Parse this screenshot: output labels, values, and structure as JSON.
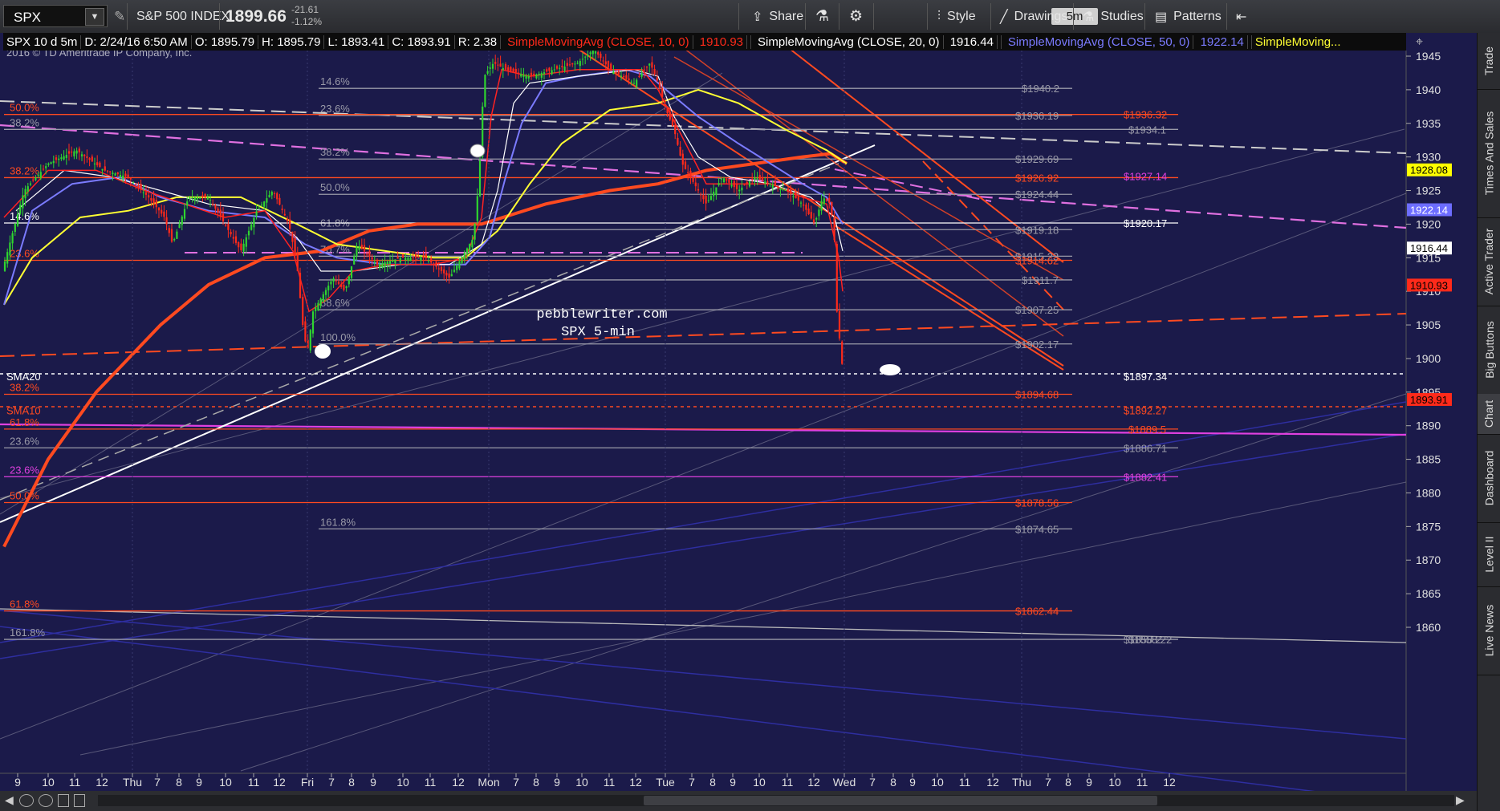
{
  "toolbar": {
    "symbol": "SPX",
    "name": "S&P 500 INDEX",
    "price": "1899.66",
    "change": "-21.61",
    "change_pct": "-1.12%",
    "share": "Share",
    "timeframe": "5m",
    "style": "Style",
    "drawings": "Drawings",
    "studies": "Studies",
    "patterns": "Patterns"
  },
  "infobar": {
    "desc": "SPX 10 d 5m",
    "date": "D: 2/24/16 6:50 AM",
    "open": "O: 1895.79",
    "high": "H: 1895.79",
    "low": "L: 1893.41",
    "close": "C: 1893.91",
    "range": "R: 2.38",
    "sma10": "SimpleMovingAvg (CLOSE, 10, 0)",
    "sma10_val": "1910.93",
    "sma20": "SimpleMovingAvg (CLOSE, 20, 0)",
    "sma20_val": "1916.44",
    "sma50": "SimpleMovingAvg (CLOSE, 50, 0)",
    "sma50_val": "1922.14",
    "sma_more": "SimpleMoving..."
  },
  "copyright": "2016 © TD Ameritrade IP Company, Inc.",
  "watermark": [
    "pebblewriter.com",
    "SPX 5-min"
  ],
  "right_nav": [
    "Trade",
    "Times And Sales",
    "Active Trader",
    "Big Buttons",
    "Chart",
    "Dashboard",
    "Level II",
    "Live News"
  ],
  "chart_data": {
    "type": "candlestick",
    "interval": "5m",
    "ylim": [
      1857,
      1948
    ],
    "yticks": [
      1860,
      1865,
      1870,
      1875,
      1880,
      1885,
      1890,
      1895,
      1900,
      1905,
      1910,
      1915,
      1920,
      1925,
      1930,
      1935,
      1940,
      1945
    ],
    "xticks": [
      {
        "label": "9",
        "x": 22
      },
      {
        "label": "10",
        "x": 60
      },
      {
        "label": "11",
        "x": 93
      },
      {
        "label": "12",
        "x": 127
      },
      {
        "label": "Thu",
        "x": 165
      },
      {
        "label": "7",
        "x": 196
      },
      {
        "label": "8",
        "x": 223
      },
      {
        "label": "9",
        "x": 248
      },
      {
        "label": "10",
        "x": 281
      },
      {
        "label": "11",
        "x": 316
      },
      {
        "label": "12",
        "x": 348
      },
      {
        "label": "Fri",
        "x": 383
      },
      {
        "label": "7",
        "x": 413
      },
      {
        "label": "8",
        "x": 438
      },
      {
        "label": "9",
        "x": 465
      },
      {
        "label": "10",
        "x": 502
      },
      {
        "label": "11",
        "x": 536
      },
      {
        "label": "12",
        "x": 571
      },
      {
        "label": "Mon",
        "x": 609
      },
      {
        "label": "7",
        "x": 643
      },
      {
        "label": "8",
        "x": 668
      },
      {
        "label": "9",
        "x": 694
      },
      {
        "label": "10",
        "x": 725
      },
      {
        "label": "11",
        "x": 759
      },
      {
        "label": "12",
        "x": 792
      },
      {
        "label": "Tue",
        "x": 829
      },
      {
        "label": "7",
        "x": 862
      },
      {
        "label": "8",
        "x": 888
      },
      {
        "label": "9",
        "x": 913
      },
      {
        "label": "10",
        "x": 946
      },
      {
        "label": "11",
        "x": 981
      },
      {
        "label": "12",
        "x": 1014
      },
      {
        "label": "Wed",
        "x": 1052
      },
      {
        "label": "7",
        "x": 1087
      },
      {
        "label": "8",
        "x": 1113
      },
      {
        "label": "9",
        "x": 1137
      },
      {
        "label": "10",
        "x": 1168
      },
      {
        "label": "11",
        "x": 1202
      },
      {
        "label": "12",
        "x": 1237
      },
      {
        "label": "Thu",
        "x": 1273
      },
      {
        "label": "7",
        "x": 1306
      },
      {
        "label": "8",
        "x": 1331
      },
      {
        "label": "9",
        "x": 1357
      },
      {
        "label": "10",
        "x": 1389
      },
      {
        "label": "11",
        "x": 1423
      },
      {
        "label": "12",
        "x": 1457
      }
    ],
    "price_path": [
      [
        5,
        1914
      ],
      [
        30,
        1925
      ],
      [
        60,
        1929
      ],
      [
        95,
        1931
      ],
      [
        130,
        1928
      ],
      [
        160,
        1927
      ],
      [
        185,
        1924
      ],
      [
        205,
        1921
      ],
      [
        215,
        1917
      ],
      [
        235,
        1924
      ],
      [
        260,
        1924
      ],
      [
        285,
        1919
      ],
      [
        300,
        1916
      ],
      [
        320,
        1922
      ],
      [
        340,
        1925
      ],
      [
        360,
        1920
      ],
      [
        370,
        1914
      ],
      [
        378,
        1904
      ],
      [
        383,
        1901
      ],
      [
        390,
        1907
      ],
      [
        400,
        1909
      ],
      [
        415,
        1912
      ],
      [
        430,
        1910
      ],
      [
        445,
        1917
      ],
      [
        470,
        1914
      ],
      [
        500,
        1915
      ],
      [
        530,
        1915
      ],
      [
        560,
        1912
      ],
      [
        575,
        1915
      ],
      [
        590,
        1918
      ],
      [
        597,
        1927
      ],
      [
        603,
        1942
      ],
      [
        615,
        1944
      ],
      [
        630,
        1943
      ],
      [
        660,
        1942
      ],
      [
        690,
        1943
      ],
      [
        720,
        1944
      ],
      [
        740,
        1946
      ],
      [
        760,
        1943
      ],
      [
        790,
        1941
      ],
      [
        810,
        1944
      ],
      [
        820,
        1941
      ],
      [
        830,
        1937
      ],
      [
        840,
        1934
      ],
      [
        850,
        1929
      ],
      [
        865,
        1926
      ],
      [
        880,
        1923
      ],
      [
        900,
        1927
      ],
      [
        920,
        1925
      ],
      [
        940,
        1927
      ],
      [
        960,
        1926
      ],
      [
        980,
        1925
      ],
      [
        1000,
        1923
      ],
      [
        1015,
        1920
      ],
      [
        1025,
        1924
      ],
      [
        1035,
        1923
      ],
      [
        1041,
        1916
      ],
      [
        1043,
        1906
      ],
      [
        1048,
        1901
      ],
      [
        1052,
        1895
      ],
      [
        1053,
        1894
      ]
    ],
    "sma10_path": [
      [
        5,
        1921
      ],
      [
        60,
        1928
      ],
      [
        120,
        1928
      ],
      [
        180,
        1925
      ],
      [
        230,
        1923
      ],
      [
        280,
        1921
      ],
      [
        330,
        1922
      ],
      [
        365,
        1916
      ],
      [
        385,
        1907
      ],
      [
        410,
        1909
      ],
      [
        440,
        1913
      ],
      [
        480,
        1914
      ],
      [
        540,
        1914
      ],
      [
        580,
        1915
      ],
      [
        600,
        1921
      ],
      [
        612,
        1936
      ],
      [
        625,
        1943
      ],
      [
        660,
        1942
      ],
      [
        720,
        1943
      ],
      [
        760,
        1943
      ],
      [
        800,
        1943
      ],
      [
        820,
        1940
      ],
      [
        850,
        1933
      ],
      [
        880,
        1926
      ],
      [
        920,
        1926
      ],
      [
        960,
        1926
      ],
      [
        1000,
        1924
      ],
      [
        1030,
        1923
      ],
      [
        1045,
        1915
      ],
      [
        1050,
        1910
      ]
    ],
    "sma20_path": [
      [
        20,
        1922
      ],
      [
        80,
        1928
      ],
      [
        140,
        1927
      ],
      [
        200,
        1925
      ],
      [
        260,
        1923
      ],
      [
        330,
        1922
      ],
      [
        370,
        1918
      ],
      [
        400,
        1913
      ],
      [
        440,
        1913
      ],
      [
        500,
        1914
      ],
      [
        560,
        1914
      ],
      [
        600,
        1917
      ],
      [
        620,
        1925
      ],
      [
        640,
        1938
      ],
      [
        660,
        1941
      ],
      [
        720,
        1942
      ],
      [
        790,
        1943
      ],
      [
        820,
        1942
      ],
      [
        840,
        1936
      ],
      [
        870,
        1930
      ],
      [
        910,
        1927
      ],
      [
        960,
        1926
      ],
      [
        1010,
        1924
      ],
      [
        1040,
        1921
      ],
      [
        1050,
        1916
      ]
    ],
    "sma50_path": [
      [
        5,
        1908
      ],
      [
        40,
        1922
      ],
      [
        90,
        1926
      ],
      [
        150,
        1927
      ],
      [
        200,
        1924
      ],
      [
        260,
        1922
      ],
      [
        330,
        1921
      ],
      [
        380,
        1917
      ],
      [
        420,
        1915
      ],
      [
        480,
        1914
      ],
      [
        540,
        1914
      ],
      [
        580,
        1914
      ],
      [
        610,
        1918
      ],
      [
        630,
        1927
      ],
      [
        650,
        1935
      ],
      [
        680,
        1941
      ],
      [
        720,
        1942
      ],
      [
        780,
        1943
      ],
      [
        810,
        1942
      ],
      [
        840,
        1939
      ],
      [
        870,
        1936
      ],
      [
        920,
        1932
      ],
      [
        960,
        1929
      ],
      [
        1000,
        1926
      ],
      [
        1030,
        1924
      ],
      [
        1050,
        1920
      ]
    ],
    "sma100_path": [
      [
        5,
        1908
      ],
      [
        40,
        1915
      ],
      [
        100,
        1921
      ],
      [
        160,
        1922
      ],
      [
        220,
        1924
      ],
      [
        300,
        1924
      ],
      [
        370,
        1920
      ],
      [
        420,
        1917
      ],
      [
        480,
        1916
      ],
      [
        540,
        1915
      ],
      [
        580,
        1915
      ],
      [
        620,
        1919
      ],
      [
        660,
        1926
      ],
      [
        700,
        1932
      ],
      [
        760,
        1937
      ],
      [
        820,
        1938
      ],
      [
        870,
        1940
      ],
      [
        920,
        1938
      ],
      [
        980,
        1934
      ],
      [
        1030,
        1931
      ],
      [
        1055,
        1929
      ]
    ],
    "sma200_path": [
      [
        5,
        1872
      ],
      [
        60,
        1885
      ],
      [
        120,
        1895
      ],
      [
        200,
        1905
      ],
      [
        260,
        1911
      ],
      [
        330,
        1915
      ],
      [
        400,
        1916
      ],
      [
        460,
        1919
      ],
      [
        520,
        1920
      ],
      [
        600,
        1920
      ],
      [
        680,
        1923
      ],
      [
        760,
        1925
      ],
      [
        820,
        1926
      ],
      [
        880,
        1928
      ],
      [
        940,
        1929
      ],
      [
        1000,
        1930
      ],
      [
        1035,
        1930.5
      ],
      [
        1055,
        1929
      ]
    ],
    "fib_lines": [
      {
        "label": "14.6%",
        "label_x": 397,
        "value": 1940.2,
        "x1": 397,
        "x2": 1336,
        "color": "#9a9aa8"
      },
      {
        "label": "23.6%",
        "label_x": 397,
        "value": 1936.19,
        "x1": 397,
        "x2": 1336,
        "color": "#9a9aa8"
      },
      {
        "label": "38.2%",
        "label_x": 397,
        "value": 1929.69,
        "x1": 397,
        "x2": 1336,
        "color": "#9a9aa8"
      },
      {
        "label": "50.0%",
        "label_x": 397,
        "value": 1924.44,
        "x1": 397,
        "x2": 1336,
        "color": "#9a9aa8"
      },
      {
        "label": "61.8%",
        "label_x": 397,
        "value": 1919.18,
        "x1": 397,
        "x2": 1336,
        "color": "#9a9aa8"
      },
      {
        "label": "70.7%",
        "label_x": 397,
        "value": 1915.23,
        "x1": 397,
        "x2": 1336,
        "color": "#9a9aa8"
      },
      {
        "label": "",
        "label_x": 397,
        "value": 1911.7,
        "x1": 397,
        "x2": 1336,
        "color": "#9a9aa8"
      },
      {
        "label": "88.6%",
        "label_x": 397,
        "value": 1907.25,
        "x1": 397,
        "x2": 1336,
        "color": "#9a9aa8"
      },
      {
        "label": "100.0%",
        "label_x": 397,
        "value": 1902.17,
        "x1": 397,
        "x2": 1336,
        "color": "#9a9aa8"
      },
      {
        "label": "161.8%",
        "label_x": 397,
        "value": 1874.65,
        "x1": 397,
        "x2": 1336,
        "color": "#9a9aa8"
      },
      {
        "label": "50.0%",
        "label_x": 10,
        "value": 1936.32,
        "x1": 5,
        "x2": 1468,
        "color": "#ff4a20"
      },
      {
        "label": "38.2%",
        "label_x": 10,
        "value": 1934.1,
        "x1": 5,
        "x2": 1468,
        "color": "#9a9aa8"
      },
      {
        "label": "38.2%",
        "label_x": 10,
        "value": 1926.92,
        "x1": 5,
        "x2": 1468,
        "color": "#ff4a20"
      },
      {
        "label": "14.6%",
        "label_x": 10,
        "value": 1920.17,
        "x1": 5,
        "x2": 1468,
        "color": "#ffffff"
      },
      {
        "label": "23.6%",
        "label_x": 10,
        "value": 1914.62,
        "x1": 5,
        "x2": 1336,
        "color": "#ff4a20"
      },
      {
        "label": "38.2%",
        "label_x": 10,
        "value": 1894.68,
        "x1": 5,
        "x2": 1336,
        "color": "#ff4a20"
      },
      {
        "label": "61.8%",
        "label_x": 10,
        "value": 1889.5,
        "x1": 5,
        "x2": 1468,
        "color": "#ff4a20"
      },
      {
        "label": "23.6%",
        "label_x": 10,
        "value": 1886.71,
        "x1": 5,
        "x2": 1468,
        "color": "#9a9aa8"
      },
      {
        "label": "23.6%",
        "label_x": 10,
        "value": 1882.41,
        "x1": 5,
        "x2": 1468,
        "color": "#e040e0"
      },
      {
        "label": "50.0%",
        "label_x": 10,
        "value": 1878.56,
        "x1": 5,
        "x2": 1336,
        "color": "#ff4a20"
      },
      {
        "label": "61.8%",
        "label_x": 10,
        "value": 1862.44,
        "x1": 5,
        "x2": 1336,
        "color": "#ff4a20"
      },
      {
        "label": "161.8%",
        "label_x": 10,
        "value": 1858.2,
        "x1": 5,
        "x2": 1468,
        "color": "#9a9aa8"
      }
    ],
    "right_labels": [
      {
        "text": "$1940.2",
        "value": 1940.2,
        "x": 1273,
        "color": "#9a9aa8"
      },
      {
        "text": "$1936.19",
        "value": 1936.19,
        "x": 1265,
        "color": "#9a9aa8"
      },
      {
        "text": "$1936.32",
        "value": 1936.32,
        "x": 1400,
        "color": "#ff4a20"
      },
      {
        "text": "$1934.1",
        "value": 1934.1,
        "x": 1406,
        "color": "#9a9aa8"
      },
      {
        "text": "$1929.69",
        "value": 1929.69,
        "x": 1265,
        "color": "#9a9aa8"
      },
      {
        "text": "$1926.92",
        "value": 1926.92,
        "x": 1265,
        "color": "#ff4a20"
      },
      {
        "text": "$1927.14",
        "value": 1927.14,
        "x": 1400,
        "color": "#e040e0"
      },
      {
        "text": "$1924.44",
        "value": 1924.44,
        "x": 1265,
        "color": "#9a9aa8"
      },
      {
        "text": "$1920.17",
        "value": 1920.17,
        "x": 1400,
        "color": "#ffffff"
      },
      {
        "text": "$1919.18",
        "value": 1919.18,
        "x": 1265,
        "color": "#9a9aa8"
      },
      {
        "text": "$1915.23",
        "value": 1915.23,
        "x": 1265,
        "color": "#9a9aa8"
      },
      {
        "text": "$1914.62",
        "value": 1914.62,
        "x": 1265,
        "color": "#ff4a20"
      },
      {
        "text": "$1911.7",
        "value": 1911.7,
        "x": 1273,
        "color": "#9a9aa8"
      },
      {
        "text": "$1907.25",
        "value": 1907.25,
        "x": 1265,
        "color": "#9a9aa8"
      },
      {
        "text": "$1902.17",
        "value": 1902.17,
        "x": 1265,
        "color": "#9a9aa8"
      },
      {
        "text": "$1897.34",
        "value": 1897.34,
        "x": 1400,
        "color": "#ffffff"
      },
      {
        "text": "$1894.68",
        "value": 1894.68,
        "x": 1265,
        "color": "#ff4a20"
      },
      {
        "text": "$1892.27",
        "value": 1892.27,
        "x": 1400,
        "color": "#ff4a20"
      },
      {
        "text": "$1889.5",
        "value": 1889.5,
        "x": 1406,
        "color": "#ff4a20"
      },
      {
        "text": "$1886.71",
        "value": 1886.71,
        "x": 1400,
        "color": "#9a9aa8"
      },
      {
        "text": "$1882.41",
        "value": 1882.41,
        "x": 1400,
        "color": "#e040e0"
      },
      {
        "text": "$1878.56",
        "value": 1878.56,
        "x": 1265,
        "color": "#ff4a20"
      },
      {
        "text": "$1874.65",
        "value": 1874.65,
        "x": 1265,
        "color": "#9a9aa8"
      },
      {
        "text": "$1862.44",
        "value": 1862.44,
        "x": 1265,
        "color": "#ff4a20"
      },
      {
        "text": "$1858.2",
        "value": 1858.2,
        "x": 1400,
        "color": "#9a9aa8"
      },
      {
        "text": "$1858.22",
        "value": 1858.22,
        "x": 1406,
        "color": "#9a9aa8"
      }
    ],
    "left_labels": [
      {
        "text": "SMA20",
        "value": 1897.34,
        "color": "#ffffff"
      },
      {
        "text": "SMA10",
        "value": 1892.27,
        "color": "#ff4a20"
      }
    ],
    "axis_badges": [
      {
        "text": "1928.08",
        "value": 1928.08,
        "bg": "#ffff00",
        "fg": "#000000"
      },
      {
        "text": "1922.14",
        "value": 1922.14,
        "bg": "#6d6dff",
        "fg": "#ffffff"
      },
      {
        "text": "1916.44",
        "value": 1916.44,
        "bg": "#ffffff",
        "fg": "#000000"
      },
      {
        "text": "1910.93",
        "value": 1910.93,
        "bg": "#ff2a1a",
        "fg": "#000000"
      },
      {
        "text": "1893.91",
        "value": 1893.91,
        "bg": "#ff2a1a",
        "fg": "#000000"
      }
    ],
    "colors": {
      "background": "#1b1a4a",
      "sma10": "#ff2222",
      "sma20": "#ffffff",
      "sma50": "#7b7bff",
      "sma100": "#ffff33",
      "sma200": "#ff4a20",
      "fib": "#ff4a20",
      "magenta": "#e040e0"
    }
  }
}
